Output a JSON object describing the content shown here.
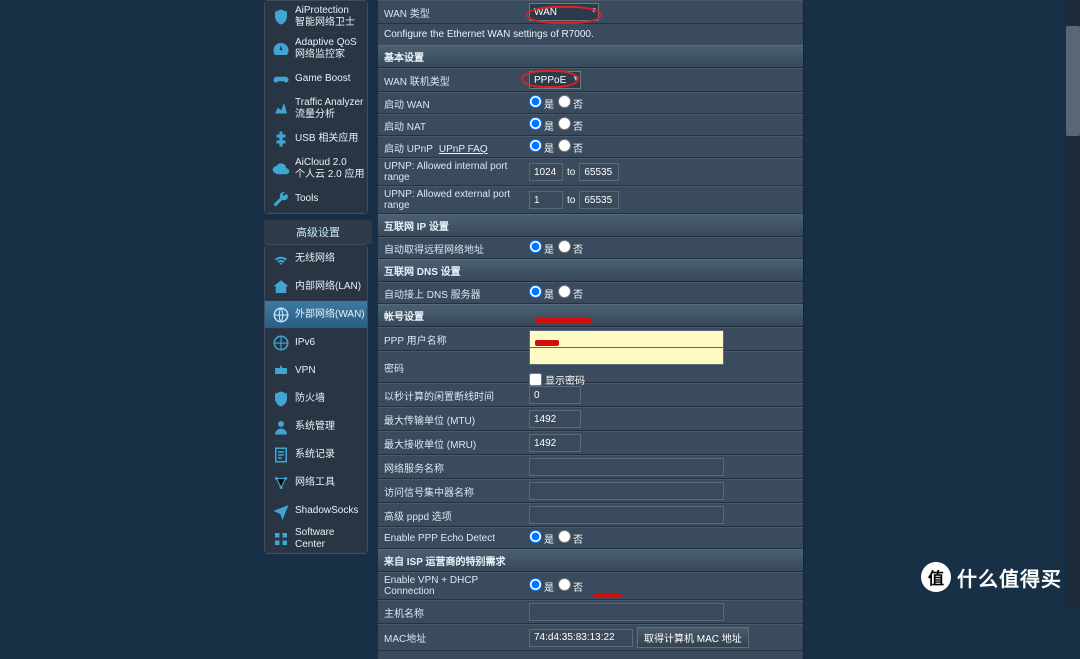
{
  "sidebar1": {
    "items": [
      {
        "t1": "AiProtection",
        "t2": "智能网络卫士"
      },
      {
        "t1": "Adaptive QoS",
        "t2": "网络监控家"
      },
      {
        "t1": "Game Boost",
        "t2": ""
      },
      {
        "t1": "Traffic Analyzer",
        "t2": "流量分析"
      },
      {
        "t1": "USB 相关应用",
        "t2": ""
      },
      {
        "t1": "AiCloud 2.0",
        "t2": "个人云 2.0 应用"
      },
      {
        "t1": "Tools",
        "t2": ""
      }
    ]
  },
  "adv_header": "高级设置",
  "sidebar2": {
    "items": [
      {
        "label": "无线网络"
      },
      {
        "label": "内部网络(LAN)"
      },
      {
        "label": "外部网络(WAN)"
      },
      {
        "label": "IPv6"
      },
      {
        "label": "VPN"
      },
      {
        "label": "防火墙"
      },
      {
        "label": "系统管理"
      },
      {
        "label": "系统记录"
      },
      {
        "label": "网络工具"
      },
      {
        "label": "ShadowSocks"
      },
      {
        "label": "Software Center"
      }
    ]
  },
  "wan_type": {
    "label": "WAN 类型",
    "value": "WAN"
  },
  "config_desc": "Configure the Ethernet WAN settings of R7000.",
  "sect_basic": "基本设置",
  "rows": {
    "conn": {
      "label": "WAN 联机类型",
      "value": "PPPoE"
    },
    "enable_wan": {
      "label": "启动 WAN",
      "yes": "是",
      "no": "否"
    },
    "enable_nat": {
      "label": "启动 NAT",
      "yes": "是",
      "no": "否"
    },
    "enable_upnp": {
      "label": "启动 UPnP",
      "yes": "是",
      "no": "否",
      "faq": "UPnP   FAQ"
    },
    "upnp_int": {
      "label": "UPNP: Allowed internal port range",
      "v1": "1024",
      "v2": "65535",
      "to": "to"
    },
    "upnp_ext": {
      "label": "UPNP: Allowed external port range",
      "v1": "1",
      "v2": "65535",
      "to": "to"
    }
  },
  "sect_ip": "互联网 IP 设置",
  "auto_ip": {
    "label": "自动取得远程网络地址",
    "yes": "是",
    "no": "否"
  },
  "sect_dns": "互联网 DNS 设置",
  "auto_dns": {
    "label": "自动接上 DNS 服务器",
    "yes": "是",
    "no": "否"
  },
  "sect_acct": "帐号设置",
  "acct": {
    "user": "PPP 用户名称",
    "pass": "密码",
    "showpass": "显示密码",
    "idle": {
      "label": "以秒计算的闲置断线时间",
      "v": "0"
    },
    "mtu": {
      "label": "最大传输单位 (MTU)",
      "v": "1492"
    },
    "mru": {
      "label": "最大接收单位 (MRU)",
      "v": "1492"
    },
    "svc": "网络服务名称",
    "conc": "访问信号集中器名称",
    "pppd": "高级 pppd 选项",
    "echo": {
      "label": "Enable PPP Echo Detect",
      "yes": "是",
      "no": "否"
    }
  },
  "sect_isp": "来自 ISP 运营商的特别需求",
  "isp": {
    "vpn": {
      "label": "Enable VPN + DHCP Connection",
      "yes": "是",
      "no": "否"
    },
    "host": "主机名称",
    "mac": {
      "label": "MAC地址",
      "v": "74:d4:35:83:13:22",
      "btn": "取得计算机 MAC 地址"
    }
  },
  "watermark": {
    "badge": "值",
    "text": "什么值得买"
  }
}
